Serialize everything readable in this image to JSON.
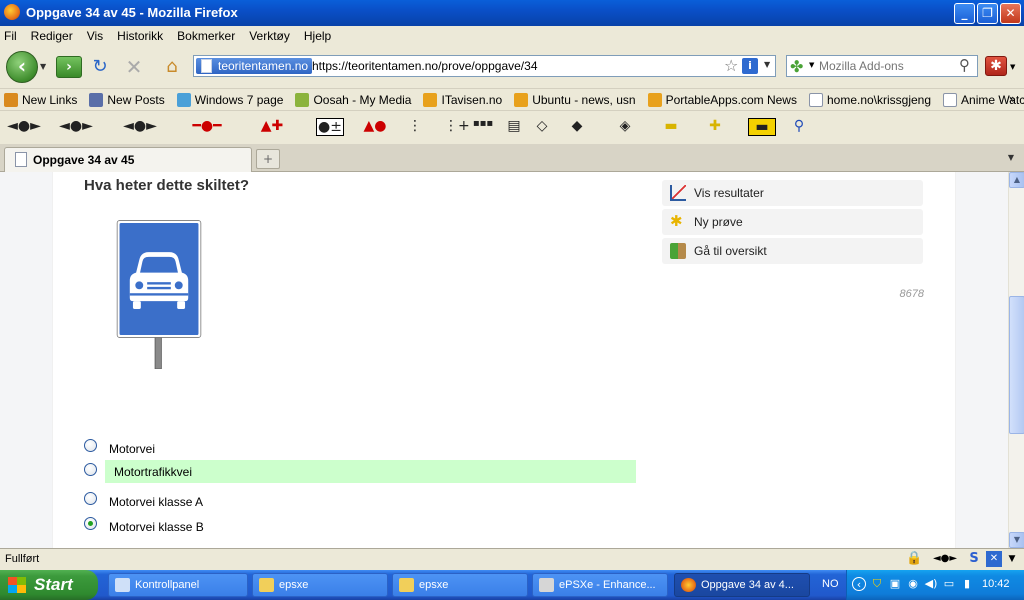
{
  "window": {
    "title": "Oppgave 34 av 45 - Mozilla Firefox",
    "buttons": [
      "_",
      "❐",
      "✕"
    ]
  },
  "menu": [
    "Fil",
    "Rediger",
    "Vis",
    "Historikk",
    "Bokmerker",
    "Verktøy",
    "Hjelp"
  ],
  "nav": {
    "site_identity": "teoritentamen.no",
    "url": "https://teoritentamen.no/prove/oppgave/34",
    "search_placeholder": "Mozilla Add-ons"
  },
  "bookmarks": [
    {
      "label": "New Links",
      "color": "#d98a1e"
    },
    {
      "label": "New Posts",
      "color": "#5a6fa8"
    },
    {
      "label": "Windows 7 page",
      "color": "#4aa0d8"
    },
    {
      "label": "Oosah - My Media",
      "color": "#8bb33c"
    },
    {
      "label": "ITavisen.no",
      "color": "#e8a11c"
    },
    {
      "label": "Ubuntu - news, usn",
      "color": "#e8a11c"
    },
    {
      "label": "PortableApps.com News",
      "color": "#e8a11c"
    },
    {
      "label": "home.no\\krissgjeng",
      "color": "#ffffff"
    },
    {
      "label": "Anime Watcher (kristi...",
      "color": "#ffffff"
    }
  ],
  "bookmarks_more": "»",
  "tab": {
    "label": "Oppgave 34 av 45",
    "new_tab": "+"
  },
  "page": {
    "question": "Hva heter dette skiltet?",
    "side_links": [
      {
        "label": "Vis resultater",
        "icon": "chart-icon"
      },
      {
        "label": "Ny prøve",
        "icon": "star-icon"
      },
      {
        "label": "Gå til oversikt",
        "icon": "exit-icon"
      }
    ],
    "counter": "8678",
    "answers": [
      {
        "label": "Motorvei",
        "checked": false,
        "correct": false
      },
      {
        "label": "Motortrafikkvei",
        "checked": false,
        "correct": true
      },
      {
        "label": "Motorvei klasse A",
        "checked": false,
        "correct": false
      },
      {
        "label": "Motorvei klasse B",
        "checked": true,
        "correct": false
      }
    ],
    "sign_color": "#3b6fc9",
    "correct_highlight": "#ccffcc"
  },
  "status": {
    "text": "Fullført"
  },
  "taskbar": {
    "start": "Start",
    "tasks": [
      {
        "label": "Kontrollpanel",
        "active": false
      },
      {
        "label": "epsxe",
        "active": false
      },
      {
        "label": "epsxe",
        "active": false
      },
      {
        "label": "ePSXe - Enhance...",
        "active": false
      },
      {
        "label": "Oppgave 34 av 4...",
        "active": true
      }
    ],
    "language": "NO",
    "clock": "10:42"
  }
}
